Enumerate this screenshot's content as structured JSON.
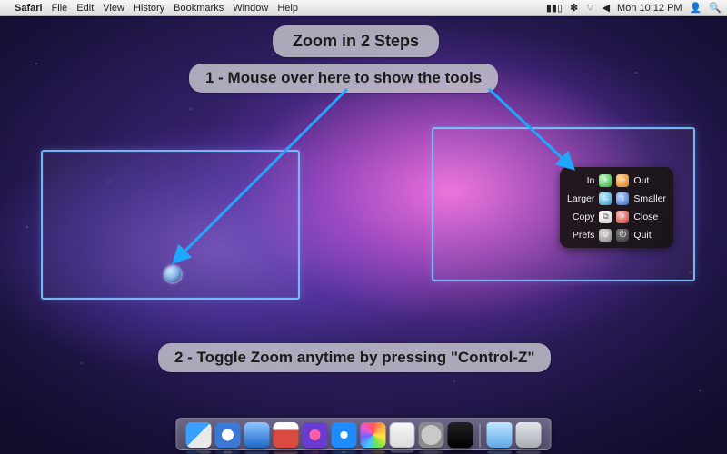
{
  "menubar": {
    "app": "Safari",
    "menus": [
      "File",
      "Edit",
      "View",
      "History",
      "Bookmarks",
      "Window",
      "Help"
    ],
    "clock": "Mon 10:12 PM",
    "battery_glyph": "▮▮▯",
    "wifi_glyph": "⌔",
    "bt_glyph": "✽",
    "vol_glyph": "◀",
    "user_glyph": "👤",
    "spotlight_glyph": "🔍"
  },
  "bubbles": {
    "title": "Zoom in 2 Steps",
    "step1_pre": "1 - Mouse over ",
    "step1_u1": "here",
    "step1_mid": " to show the ",
    "step1_u2": "tools",
    "step2": "2 - Toggle Zoom anytime by pressing \"Control-Z\""
  },
  "palette": {
    "in": "In",
    "out": "Out",
    "larger": "Larger",
    "smaller": "Smaller",
    "copy": "Copy",
    "close": "Close",
    "prefs": "Prefs",
    "quit": "Quit"
  },
  "dock": {
    "items": [
      {
        "name": "finder",
        "class": "di-finder"
      },
      {
        "name": "safari",
        "class": "di-safari"
      },
      {
        "name": "mail",
        "class": "di-mail"
      },
      {
        "name": "ical",
        "class": "di-ical"
      },
      {
        "name": "itunes",
        "class": "di-itunes"
      },
      {
        "name": "appstore",
        "class": "di-appstore"
      },
      {
        "name": "photo",
        "class": "di-photo"
      },
      {
        "name": "textedit",
        "class": "di-text"
      },
      {
        "name": "sysprefs",
        "class": "di-prefs"
      },
      {
        "name": "terminal",
        "class": "di-term"
      }
    ],
    "after_sep": [
      {
        "name": "downloads",
        "class": "di-folder"
      },
      {
        "name": "trash",
        "class": "di-trash"
      }
    ]
  },
  "colors": {
    "arrow": "#1fa6ff"
  }
}
